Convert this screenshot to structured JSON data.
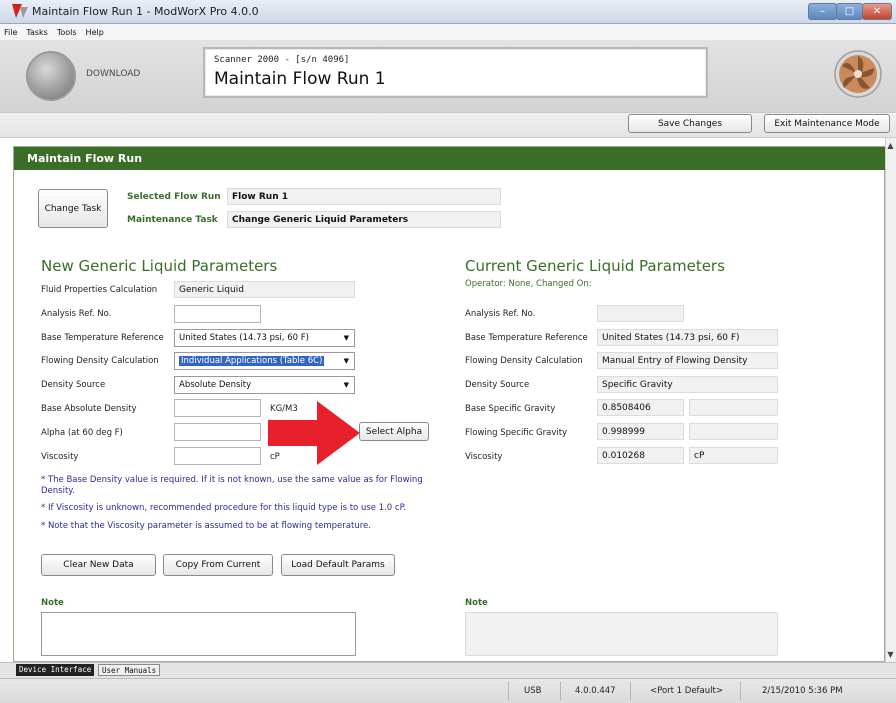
{
  "window": {
    "title": "Maintain Flow Run 1 - ModWorX Pro 4.0.0",
    "minimize_glyph": "–",
    "maximize_glyph": "□",
    "close_glyph": "✕"
  },
  "menu": {
    "items": [
      "File",
      "Tasks",
      "Tools",
      "Help"
    ]
  },
  "header": {
    "download_label": "DOWNLOAD",
    "device_id": "Scanner 2000 -  [s/n 4096]",
    "page_title": "Maintain Flow Run 1"
  },
  "toolbar": {
    "save_label": "Save Changes",
    "exit_label": "Exit Maintenance Mode"
  },
  "section": {
    "title": "Maintain Flow Run",
    "change_task_label": "Change Task",
    "selected_flow_run_label": "Selected Flow Run",
    "selected_flow_run_value": "Flow Run 1",
    "maintenance_task_label": "Maintenance Task",
    "maintenance_task_value": "Change Generic Liquid Parameters"
  },
  "new_params": {
    "heading": "New Generic Liquid Parameters",
    "fluid_calc_label": "Fluid Properties Calculation",
    "fluid_calc_value": "Generic Liquid",
    "analysis_label": "Analysis Ref. No.",
    "analysis_value": "",
    "base_temp_label": "Base Temperature Reference",
    "base_temp_value": "United States (14.73 psi, 60 F)",
    "flowing_density_label": "Flowing Density Calculation",
    "flowing_density_value": "Individual Applications (Table 6C)",
    "density_source_label": "Density Source",
    "density_source_value": "Absolute Density",
    "base_abs_density_label": "Base Absolute Density",
    "base_abs_density_value": "",
    "base_abs_density_unit": "KG/M3",
    "alpha_label": "Alpha (at 60 deg F)",
    "alpha_value": "",
    "select_alpha_label": "Select Alpha",
    "viscosity_label": "Viscosity",
    "viscosity_value": "",
    "viscosity_unit": "cP",
    "note1": "* The Base Density value is required. If it is not known, use the same value as for Flowing Density.",
    "note2": "* If Viscosity is unknown, recommended procedure for this liquid type is to use 1.0 cP.",
    "note3": "* Note that the Viscosity parameter is assumed to be at flowing temperature.",
    "clear_label": "Clear New Data",
    "copy_label": "Copy From Current",
    "load_label": "Load Default Params",
    "note_heading": "Note"
  },
  "current_params": {
    "heading": "Current Generic Liquid Parameters",
    "operator_line": "Operator: None, Changed On:",
    "analysis_label": "Analysis Ref. No.",
    "analysis_value": "",
    "base_temp_label": "Base Temperature Reference",
    "base_temp_value": "United States (14.73 psi, 60 F)",
    "flowing_density_label": "Flowing Density Calculation",
    "flowing_density_value": "Manual Entry of Flowing Density",
    "density_source_label": "Density Source",
    "density_source_value": "Specific Gravity",
    "base_sg_label": "Base Specific Gravity",
    "base_sg_value": "0.8508406",
    "flowing_sg_label": "Flowing Specific Gravity",
    "flowing_sg_value": "0.998999",
    "viscosity_label": "Viscosity",
    "viscosity_value": "0.010268",
    "viscosity_unit": "cP",
    "note_heading": "Note"
  },
  "tabs": {
    "device_interface": "Device Interface",
    "user_manuals": "User Manuals"
  },
  "status": {
    "connection": "USB",
    "version": "4.0.0.447",
    "port": "<Port 1 Default>",
    "datetime": "2/15/2010 5:36 PM"
  },
  "colors": {
    "accent_green": "#3a6e28",
    "note_blue": "#2a2a9a",
    "arrow_red": "#e8202c"
  }
}
